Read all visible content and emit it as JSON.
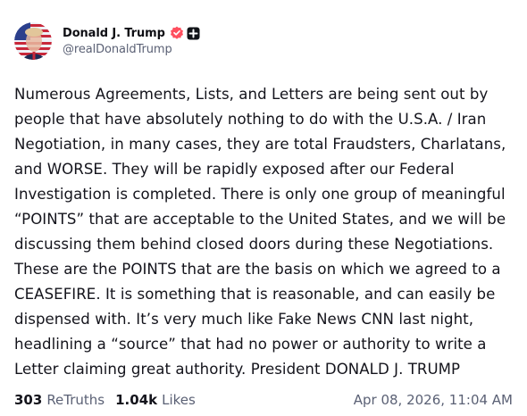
{
  "author": {
    "display_name": "Donald J. Trump",
    "handle": "@realDonaldTrump"
  },
  "post": {
    "text": "Numerous Agreements, Lists, and Letters are being sent out by\npeople that have absolutely nothing to do with the U.S.A. / Iran\nNegotiation, in many cases, they are total Fraudsters, Charlatans,\nand WORSE. They will be rapidly exposed after our Federal\nInvestigation is completed. There is only one group of meaningful\n“POINTS” that are acceptable to the United States, and we will be\ndiscussing them behind closed doors during these Negotiations.\nThese are the POINTS that are the basis on which we agreed to a\nCEASEFIRE. It is something that is reasonable, and can easily be\ndispensed with. It’s very much like Fake News CNN last night,\nheadlining a “source” that had no power or authority to write a\nLetter claiming great authority. President DONALD J. TRUMP"
  },
  "stats": {
    "retruths_count": "303",
    "retruths_label": "ReTruths",
    "likes_count": "1.04k",
    "likes_label": "Likes"
  },
  "timestamp": "Apr 08, 2026, 11:04 AM",
  "colors": {
    "verified_badge": "#ff4f5f",
    "muted_text": "#5b6175"
  },
  "icons": {
    "verified": "verified-badge-icon",
    "plus": "plus-badge-icon"
  }
}
